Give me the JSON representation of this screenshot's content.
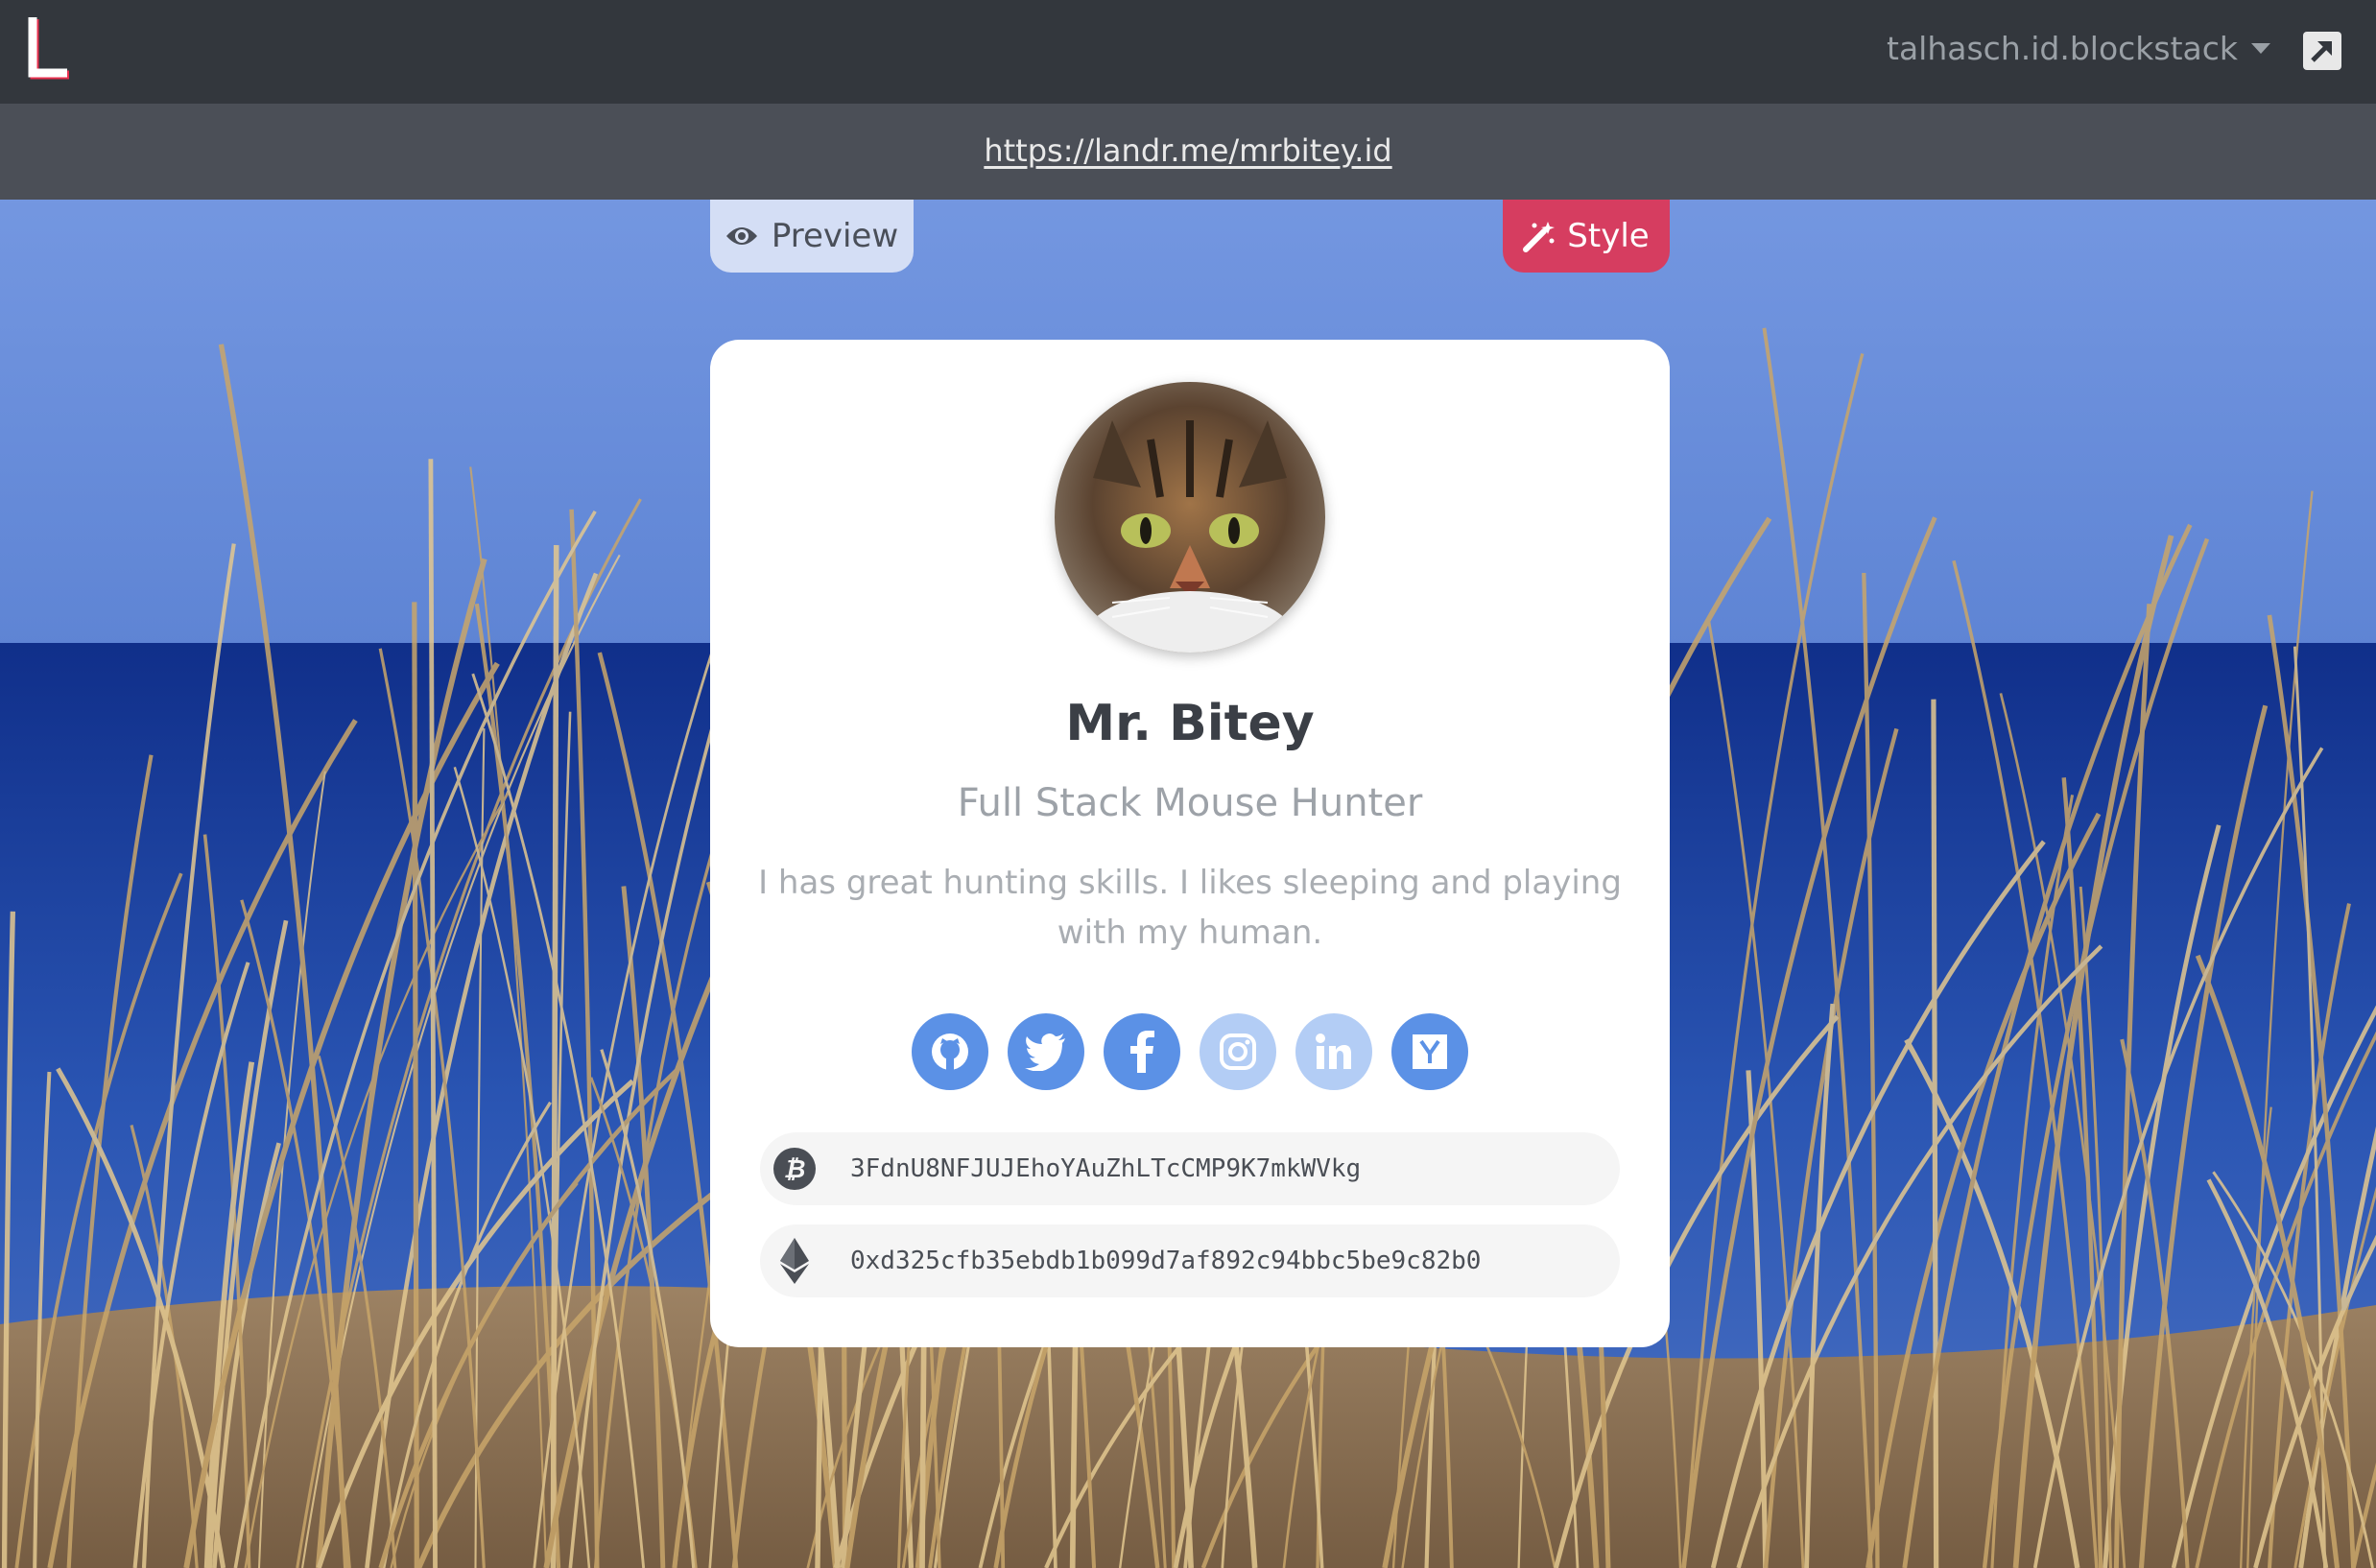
{
  "navbar": {
    "logo_letter": "L",
    "user_id": "talhasch.id.blockstack",
    "open_icon": "external-link-icon"
  },
  "urlbar": {
    "url": "https://landr.me/mrbitey.id"
  },
  "actions": {
    "preview_label": "Preview",
    "preview_icon": "eye-icon",
    "style_label": "Style",
    "style_icon": "magic-wand-icon",
    "style_color": "#d63d60"
  },
  "profile": {
    "avatar_icon": "cat-photo",
    "name": "Mr. Bitey",
    "tagline": "Full Stack Mouse Hunter",
    "bio": "I has great hunting skills. I likes sleeping and playing with my human."
  },
  "socials": [
    {
      "name": "github-icon",
      "active": true
    },
    {
      "name": "twitter-icon",
      "active": true
    },
    {
      "name": "facebook-icon",
      "active": true
    },
    {
      "name": "instagram-icon",
      "active": false
    },
    {
      "name": "linkedin-icon",
      "active": false
    },
    {
      "name": "hackernews-icon",
      "active": true
    }
  ],
  "wallets": [
    {
      "coin": "bitcoin-icon",
      "address": "3FdnU8NFJUJEhoYAuZhLTcCMP9K7mkWVkg"
    },
    {
      "coin": "ethereum-icon",
      "address": "0xd325cfb35ebdb1b099d7af892c94bbc5be9c82b0"
    }
  ],
  "colors": {
    "navbar": "#33373d",
    "urlbar": "#4b4f57",
    "social_active": "#5b91e6",
    "social_inactive": "#b3cdf5"
  }
}
